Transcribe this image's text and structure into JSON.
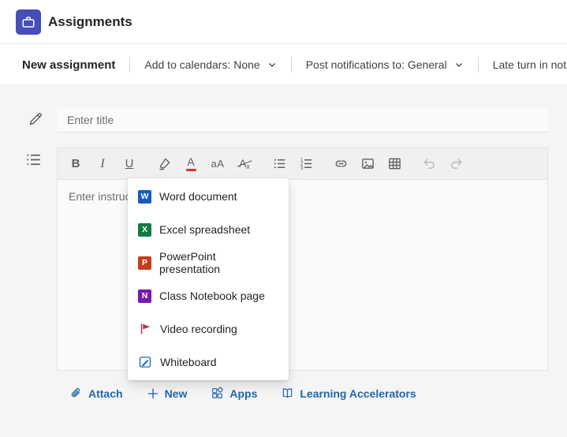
{
  "colors": {
    "brand_purple": "#464eb8",
    "action_blue": "#2166ac",
    "font_color_indicator": "#d13438"
  },
  "header": {
    "title": "Assignments"
  },
  "command_bar": {
    "new_assignment": "New assignment",
    "calendars_label": "Add to calendars: None",
    "notifications_label": "Post notifications to: General",
    "late_turn_in_label": "Late turn in notific"
  },
  "form": {
    "title_placeholder": "Enter title",
    "instructions_placeholder": "Enter instructions"
  },
  "editor_toolbar": {
    "bold": "B",
    "italic": "I",
    "underline": "U",
    "font_color": "A",
    "font_size": "aA",
    "clear_format": "A",
    "clear_format_sub": "x"
  },
  "menu": {
    "items": [
      {
        "label": "Word document",
        "letter": "W",
        "color": "#185abd"
      },
      {
        "label": "Excel spreadsheet",
        "letter": "X",
        "color": "#107c41"
      },
      {
        "label": "PowerPoint presentation",
        "letter": "P",
        "color": "#c43e1c"
      },
      {
        "label": "Class Notebook page",
        "letter": "N",
        "color": "#7719aa"
      },
      {
        "label": "Video recording",
        "icon": "video-icon",
        "color": "#c4314b"
      },
      {
        "label": "Whiteboard",
        "icon": "whiteboard-icon",
        "color": "#0f6cbd"
      }
    ]
  },
  "actions": {
    "attach": "Attach",
    "new": "New",
    "apps": "Apps",
    "learning_accelerators": "Learning Accelerators"
  }
}
